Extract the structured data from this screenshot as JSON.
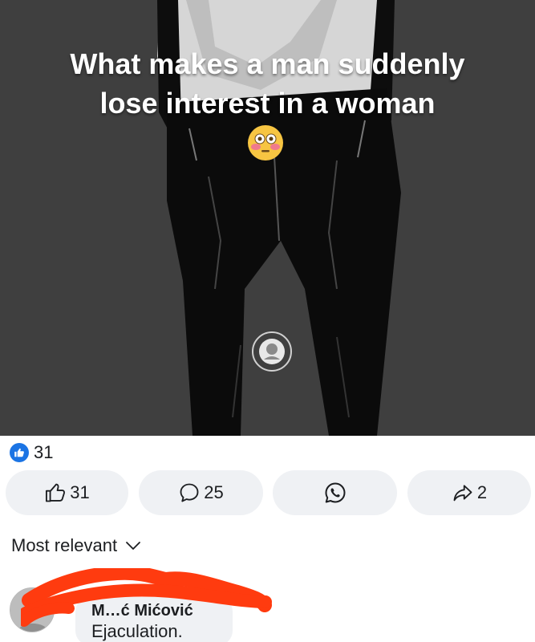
{
  "post": {
    "caption_line1": "What makes a man suddenly",
    "caption_line2": "lose interest in a woman",
    "emoji": "flushed-face",
    "watermark_icon": "circular-stamp-logo"
  },
  "reactions": {
    "icon": "like-icon",
    "count": "31"
  },
  "actions": {
    "like_count": "31",
    "comment_count": "25",
    "share_count": "2"
  },
  "comments_section": {
    "sort_label": "Most relevant"
  },
  "comment": {
    "author": "M…ć Mićović",
    "text": "Ejaculation."
  },
  "colors": {
    "accent_blue": "#1b74e4",
    "button_bg": "#eff1f4",
    "redaction": "#ff3b0f",
    "image_bg": "#3f3f3f"
  }
}
